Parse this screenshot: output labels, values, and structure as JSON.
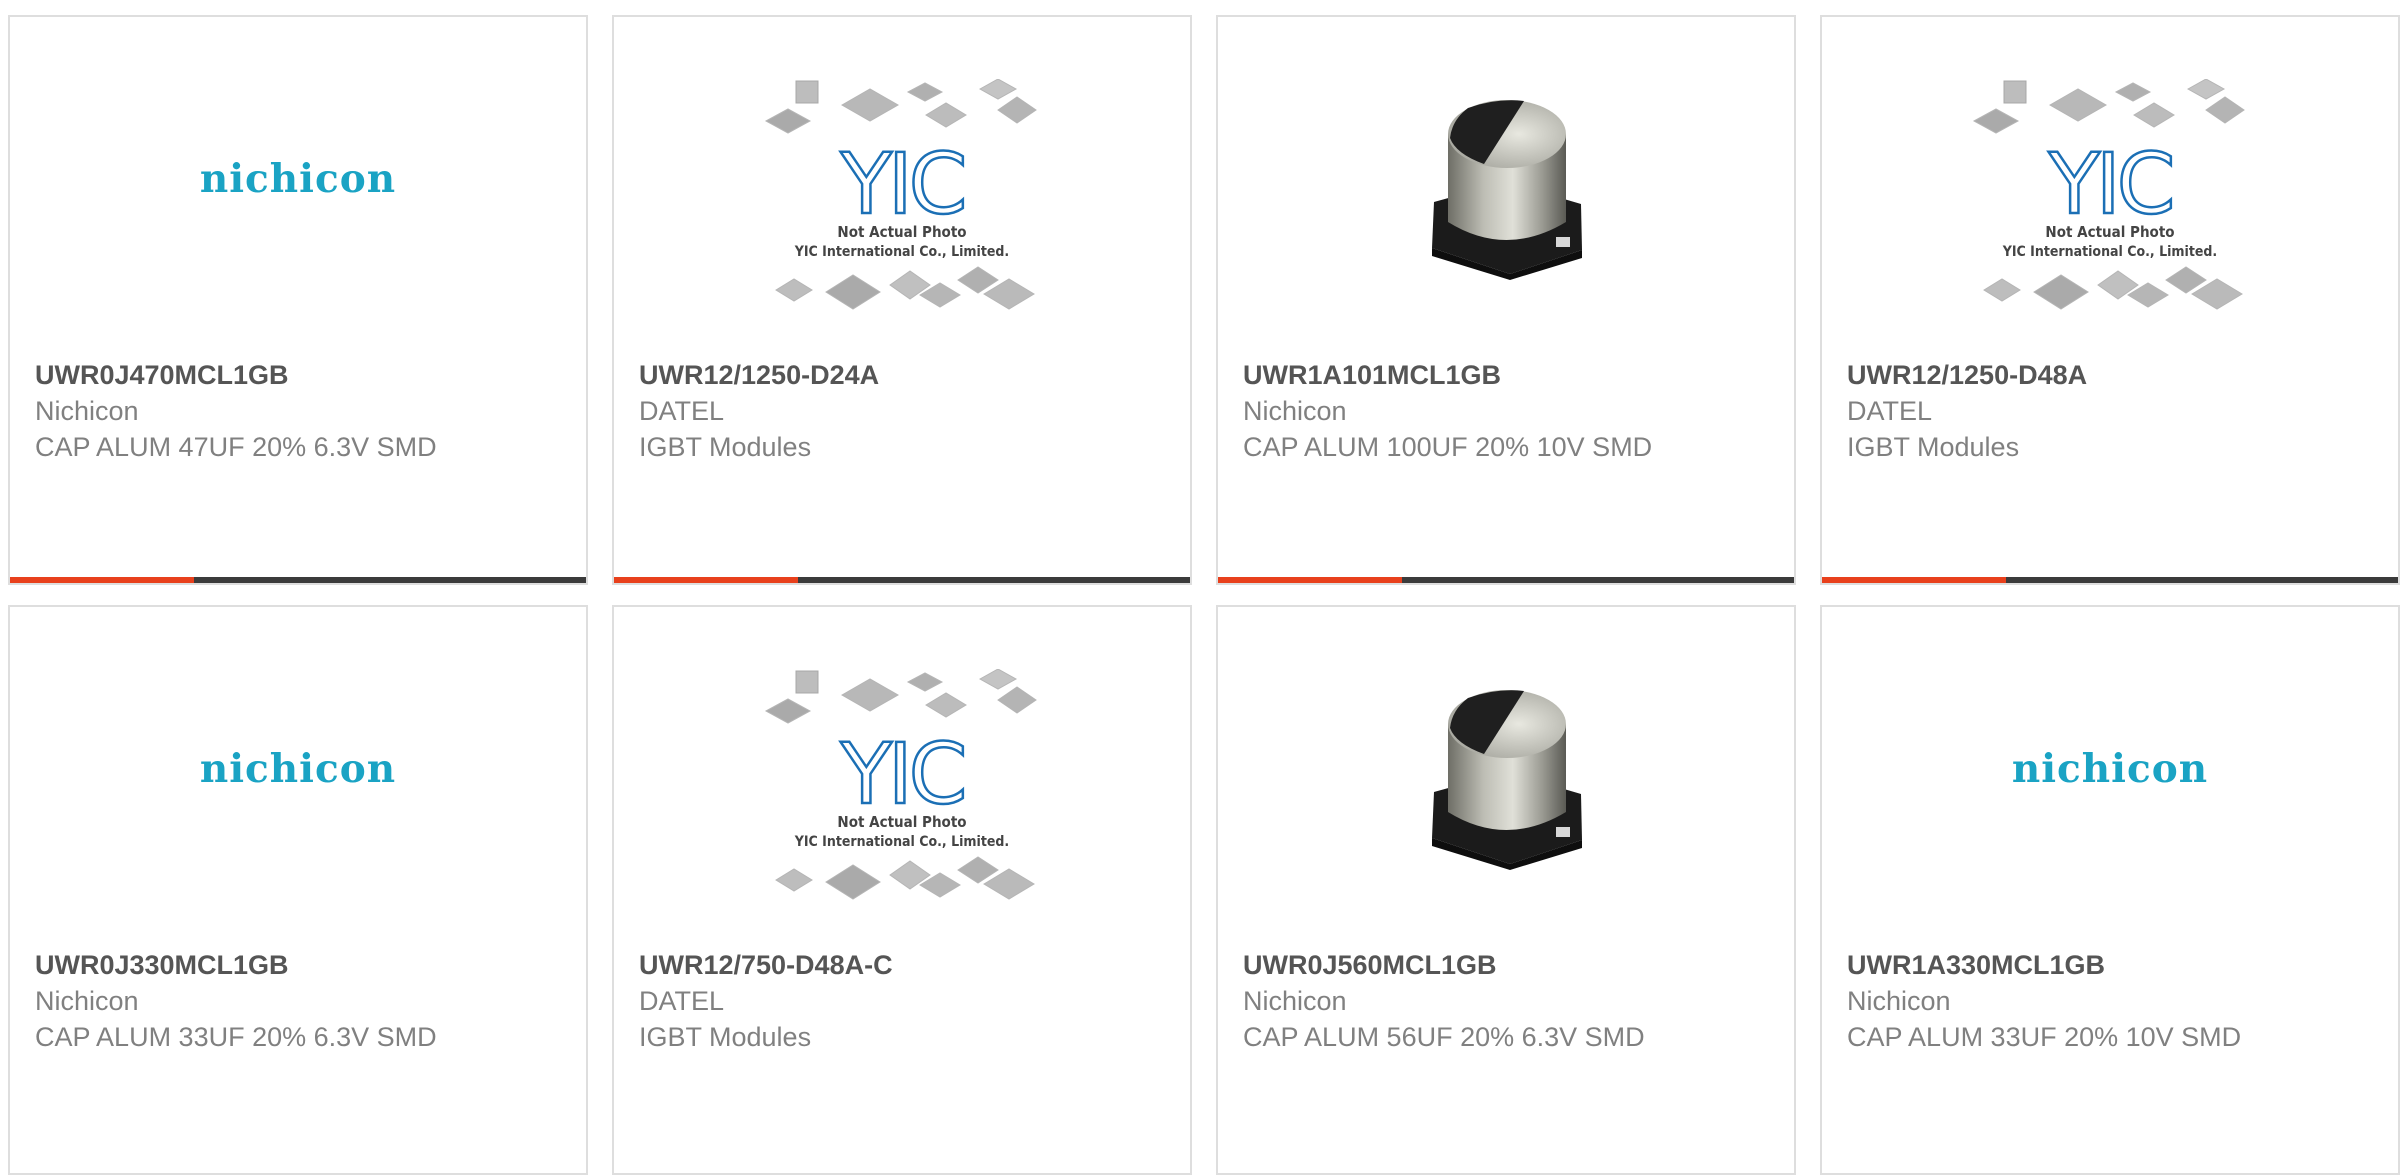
{
  "colors": {
    "accent": "#e8401c",
    "progress_track": "#3b3b3b",
    "nichicon_brand": "#1aa3c4",
    "yic_brand": "#1b6fb5",
    "card_border": "#dedede"
  },
  "placeholder_image": {
    "line1": "Not Actual Photo",
    "line2": "YIC International Co., Limited.",
    "logo": "YIC"
  },
  "brand_logo": {
    "nichicon": "nichicon"
  },
  "products": [
    {
      "part_number": "UWR0J470MCL1GB",
      "manufacturer": "Nichicon",
      "description": "CAP ALUM 47UF 20% 6.3V SMD",
      "image": "nichicon-logo",
      "progress": 0.32
    },
    {
      "part_number": "UWR12/1250-D24A",
      "manufacturer": "DATEL",
      "description": "IGBT Modules",
      "image": "yic-placeholder",
      "progress": 0.32
    },
    {
      "part_number": "UWR1A101MCL1GB",
      "manufacturer": "Nichicon",
      "description": "CAP ALUM 100UF 20% 10V SMD",
      "image": "capacitor-photo",
      "progress": 0.32
    },
    {
      "part_number": "UWR12/1250-D48A",
      "manufacturer": "DATEL",
      "description": "IGBT Modules",
      "image": "yic-placeholder",
      "progress": 0.32
    },
    {
      "part_number": "UWR0J330MCL1GB",
      "manufacturer": "Nichicon",
      "description": "CAP ALUM 33UF 20% 6.3V SMD",
      "image": "nichicon-logo",
      "progress": null
    },
    {
      "part_number": "UWR12/750-D48A-C",
      "manufacturer": "DATEL",
      "description": "IGBT Modules",
      "image": "yic-placeholder",
      "progress": null
    },
    {
      "part_number": "UWR0J560MCL1GB",
      "manufacturer": "Nichicon",
      "description": "CAP ALUM 56UF 20% 6.3V SMD",
      "image": "capacitor-photo",
      "progress": null
    },
    {
      "part_number": "UWR1A330MCL1GB",
      "manufacturer": "Nichicon",
      "description": "CAP ALUM 33UF 20% 10V SMD",
      "image": "nichicon-logo",
      "progress": null
    }
  ]
}
